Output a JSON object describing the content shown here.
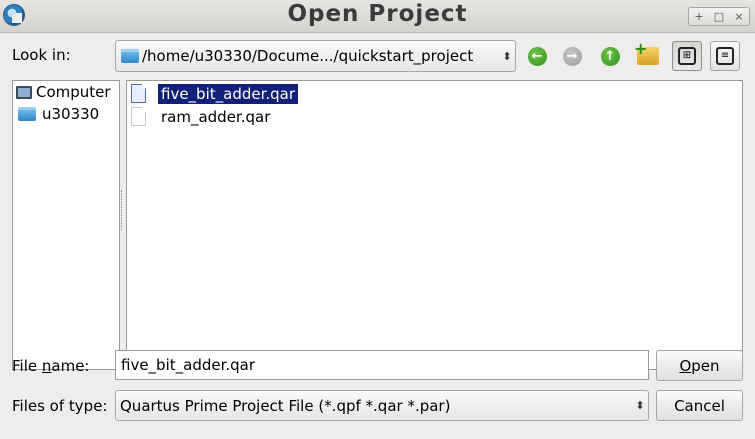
{
  "window": {
    "title": "Open Project",
    "controls": {
      "maximize": "+",
      "restore": "□",
      "close": "×"
    }
  },
  "toolbar": {
    "lookin_label": "Look in:",
    "path": "/home/u30330/Docume.../quickstart_project",
    "path_spinner": "⬍",
    "back_icon": "arrow-left-green",
    "forward_icon": "arrow-right-gray",
    "up_icon": "arrow-up-green",
    "new_folder_icon": "folder-plus",
    "icon_view_glyph": "⊞",
    "detail_view_glyph": "≡"
  },
  "sidebar": {
    "items": [
      {
        "label": "Computer",
        "icon": "computer-icon"
      },
      {
        "label": "u30330",
        "icon": "folder-icon"
      }
    ]
  },
  "files": [
    {
      "name": "five_bit_adder.qar",
      "selected": true
    },
    {
      "name": "ram_adder.qar",
      "selected": false
    }
  ],
  "form": {
    "filename_label_pre": "File ",
    "filename_label_u": "n",
    "filename_label_post": "ame:",
    "filename_value": "five_bit_adder.qar",
    "filetype_label": "Files of type:",
    "filetype_value": "Quartus Prime Project File (*.qpf *.qar *.par)",
    "filetype_spinner": "⬍",
    "open_u": "O",
    "open_rest": "pen",
    "cancel_label": "Cancel"
  },
  "colors": {
    "selection_bg": "#12207a",
    "window_bg": "#eeedeb"
  }
}
